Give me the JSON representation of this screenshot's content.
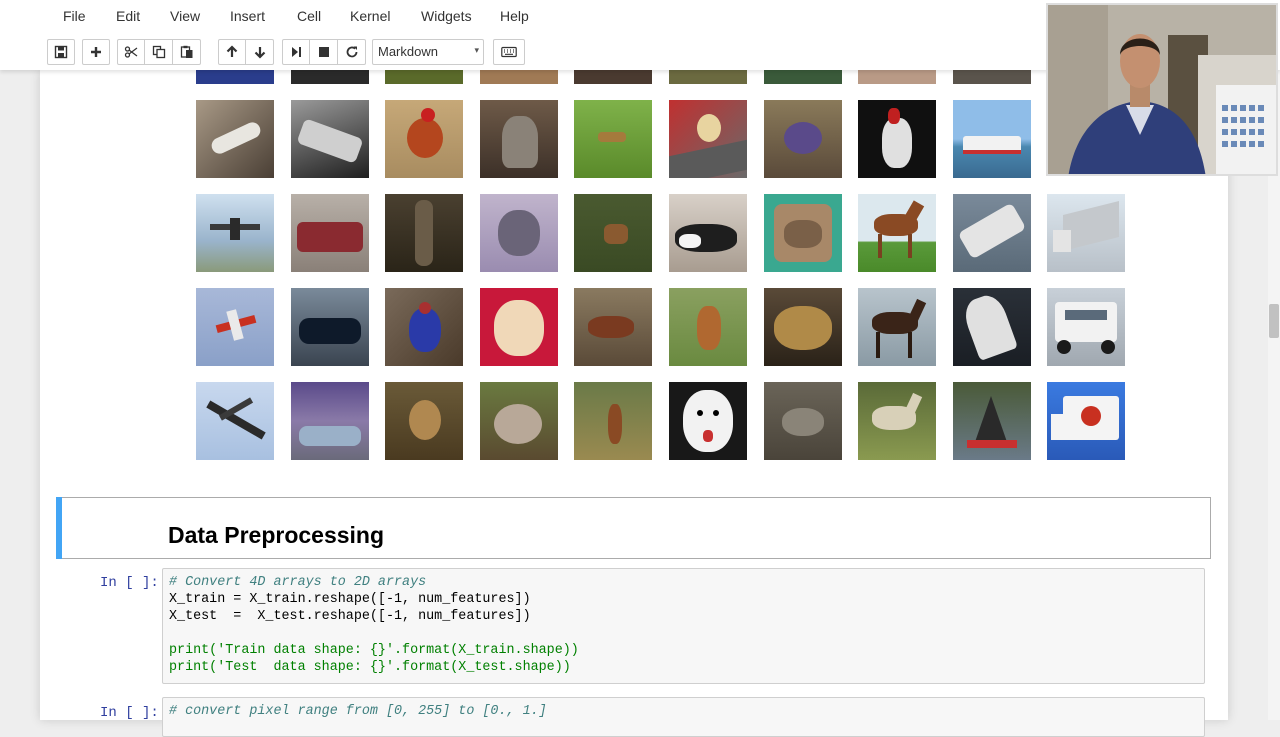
{
  "menubar": {
    "items": [
      "File",
      "Edit",
      "View",
      "Insert",
      "Cell",
      "Kernel",
      "Widgets",
      "Help"
    ]
  },
  "toolbar": {
    "buttons": [
      {
        "name": "save-button",
        "icon": "floppy-icon"
      },
      {
        "name": "insert-cell-button",
        "icon": "plus-icon"
      },
      {
        "name": "cut-button",
        "icon": "scissors-icon"
      },
      {
        "name": "copy-button",
        "icon": "copy-icon"
      },
      {
        "name": "paste-button",
        "icon": "paste-icon"
      },
      {
        "name": "move-up-button",
        "icon": "arrow-up-icon"
      },
      {
        "name": "move-down-button",
        "icon": "arrow-down-icon"
      },
      {
        "name": "run-button",
        "icon": "step-forward-icon"
      },
      {
        "name": "interrupt-button",
        "icon": "stop-icon"
      },
      {
        "name": "restart-button",
        "icon": "refresh-icon"
      },
      {
        "name": "command-palette-button",
        "icon": "keyboard-icon"
      }
    ],
    "cell_type": "Markdown"
  },
  "image_grid": {
    "description_colors": {
      "accent": "#42a5f5"
    }
  },
  "markdown_cell": {
    "heading": "Data Preprocessing"
  },
  "code_cells": [
    {
      "prompt": "In [ ]:",
      "lines": [
        "# Convert 4D arrays to 2D arrays",
        "X_train = X_train.reshape([-1, num_features])",
        "X_test  =  X_test.reshape([-1, num_features])",
        "",
        "print('Train data shape: {}'.format(X_train.shape))",
        "print('Test  data shape: {}'.format(X_test.shape))"
      ]
    },
    {
      "prompt": "In [ ]:",
      "lines": [
        "# convert pixel range from [0, 255] to [0., 1.]"
      ]
    }
  ]
}
